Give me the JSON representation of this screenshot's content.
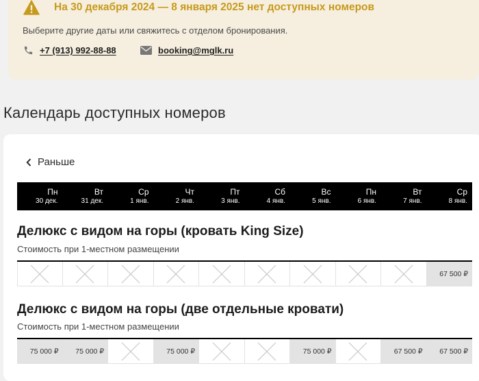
{
  "alert": {
    "title": "На 30 декабря 2024 — 8 января 2025 нет доступных номеров",
    "text": "Выберите другие даты или свяжитесь с отделом бронирования.",
    "phone": "+7 (913) 992-88-88",
    "email": "booking@mglk.ru",
    "accent_color": "#c79a1d"
  },
  "calendar": {
    "title": "Календарь доступных номеров",
    "prev_label": "Раньше",
    "days": [
      {
        "weekday": "Пн",
        "date": "30 дек."
      },
      {
        "weekday": "Вт",
        "date": "31 дек."
      },
      {
        "weekday": "Ср",
        "date": "1 янв."
      },
      {
        "weekday": "Чт",
        "date": "2 янв."
      },
      {
        "weekday": "Пт",
        "date": "3 янв."
      },
      {
        "weekday": "Сб",
        "date": "4 янв."
      },
      {
        "weekday": "Вс",
        "date": "5 янв."
      },
      {
        "weekday": "Пн",
        "date": "6 янв."
      },
      {
        "weekday": "Вт",
        "date": "7 янв."
      },
      {
        "weekday": "Ср",
        "date": "8 янв."
      }
    ],
    "rooms": [
      {
        "name": "Делюкс с видом на горы (кровать King Size)",
        "note": "Стоимость при 1-местном размещении",
        "prices": [
          null,
          null,
          null,
          null,
          null,
          null,
          null,
          null,
          null,
          "67 500 ₽"
        ]
      },
      {
        "name": "Делюкс с видом на горы (две отдельные кровати)",
        "note": "Стоимость при 1-местном размещении",
        "prices": [
          "75 000 ₽",
          "75 000 ₽",
          null,
          "75 000 ₽",
          null,
          null,
          "75 000 ₽",
          null,
          "67 500 ₽",
          "67 500 ₽"
        ]
      }
    ]
  }
}
